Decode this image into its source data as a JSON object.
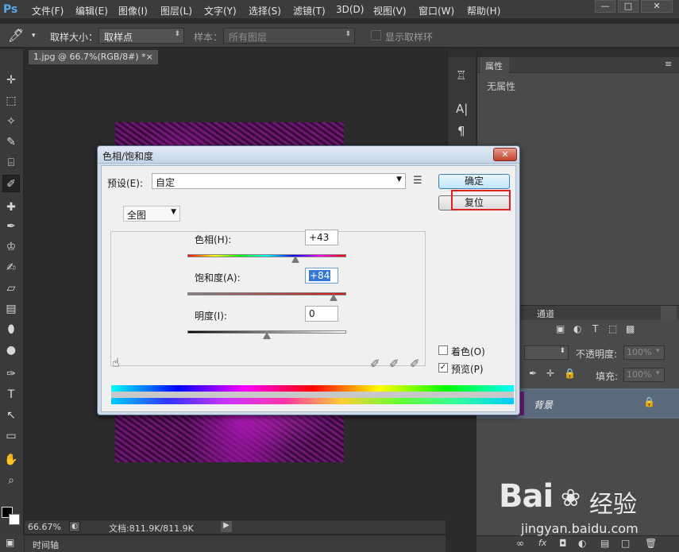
{
  "app": {
    "logo": "Ps"
  },
  "menu": [
    "文件(F)",
    "编辑(E)",
    "图像(I)",
    "图层(L)",
    "文字(Y)",
    "选择(S)",
    "滤镜(T)",
    "3D(D)",
    "视图(V)",
    "窗口(W)",
    "帮助(H)"
  ],
  "window_controls": {
    "minimize": "—",
    "maximize": "□",
    "close": "✕"
  },
  "options": {
    "sample_size_label": "取样大小：",
    "sample_size_value": "取样点",
    "sample_label": "样本：",
    "sample_value": "所有图层",
    "show_ring_label": "显示取样环"
  },
  "document": {
    "tab_title": "1.jpg @ 66.7%(RGB/8#) *",
    "tab_close": "×"
  },
  "status": {
    "zoom": "66.67%",
    "doc_size": "文档:811.9K/811.9K"
  },
  "timeline": {
    "label": "时间轴"
  },
  "properties": {
    "tab": "属性",
    "content": "无属性"
  },
  "layers": {
    "tab_paths": "通道",
    "opacity_label": "不透明度:",
    "opacity_value": "100%",
    "fill_label": "填充:",
    "fill_value": "100%",
    "layer_name": "背景"
  },
  "dialog": {
    "title": "色相/饱和度",
    "close": "✕",
    "preset_label": "预设(E):",
    "preset_value": "自定",
    "ok": "确定",
    "reset": "复位",
    "channel": "全图",
    "hue_label": "色相(H):",
    "hue_value": "+43",
    "hue_fraction": 0.68,
    "saturation_label": "饱和度(A):",
    "saturation_value": "+84",
    "saturation_fraction": 0.92,
    "lightness_label": "明度(I):",
    "lightness_value": "0",
    "lightness_fraction": 0.5,
    "colorize_label": "着色(O)",
    "colorize_checked": false,
    "preview_label": "预览(P)",
    "preview_checked": true,
    "preview_mark": "✓"
  },
  "watermark": {
    "brand": "Bai",
    "brand_cn": "经验",
    "url": "jingyan.baidu.com"
  }
}
